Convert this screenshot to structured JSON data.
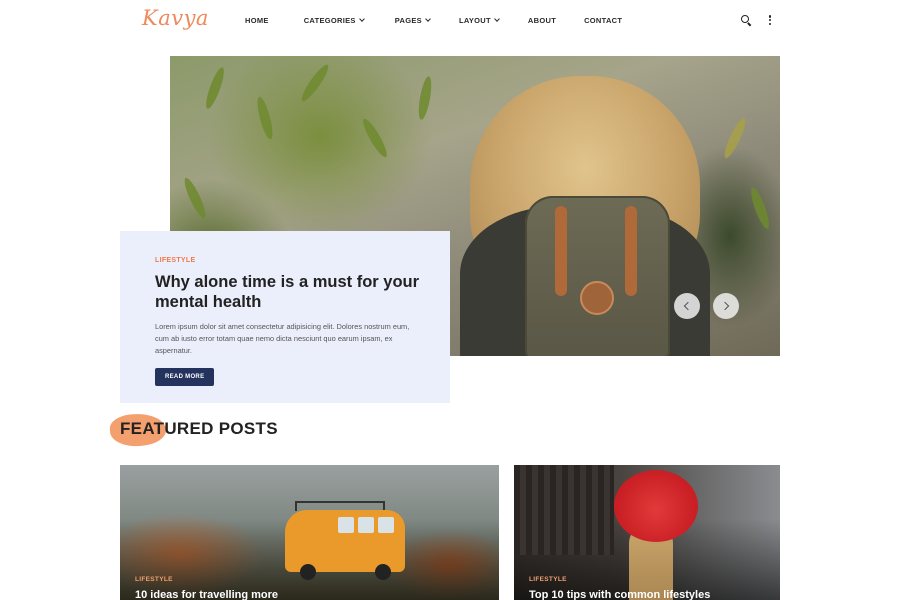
{
  "header": {
    "logo": "Kavya",
    "nav": [
      {
        "label": "HOME",
        "has_dropdown": false
      },
      {
        "label": "CATEGORIES",
        "has_dropdown": true
      },
      {
        "label": "PAGES",
        "has_dropdown": true
      },
      {
        "label": "LAYOUT",
        "has_dropdown": true
      },
      {
        "label": "ABOUT",
        "has_dropdown": false
      },
      {
        "label": "CONTACT",
        "has_dropdown": false
      }
    ],
    "icons": [
      "search-icon",
      "kebab-menu-icon"
    ]
  },
  "hero": {
    "category": "LIFESTYLE",
    "title": "Why alone time is a must for your mental health",
    "excerpt": "Lorem ipsum dolor sit amet consectetur adipisicing elit. Dolores nostrum eum, cum ab iusto error totam quae nemo dicta nesciunt quo earum ipsam, ex aspernatur.",
    "button_label": "READ MORE",
    "controls": [
      "chevron-left-icon",
      "chevron-right-icon"
    ]
  },
  "featured": {
    "heading": "FEATURED POSTS",
    "posts": [
      {
        "category": "LIFESTYLE",
        "title": "10 ideas for travelling more"
      },
      {
        "category": "LIFESTYLE",
        "title": "Top 10 tips with common lifestyles"
      }
    ]
  },
  "colors": {
    "accent": "#ee7a4c",
    "button": "#24325e",
    "card_bg": "#ebeffc",
    "brush": "#f29a66"
  }
}
